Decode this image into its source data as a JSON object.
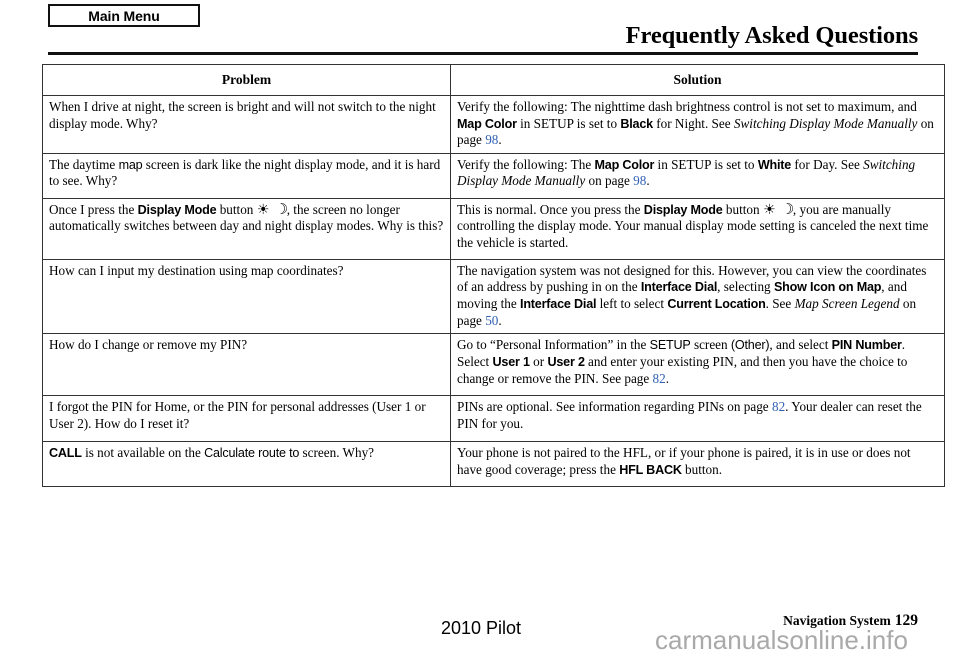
{
  "header": {
    "main_menu_label": "Main Menu",
    "title": "Frequently Asked Questions"
  },
  "table": {
    "columns": [
      "Problem",
      "Solution"
    ],
    "rows": [
      {
        "problem": "When I drive at night, the screen is bright and will not switch to the night display mode. Why?",
        "solution": "Verify the following: The nighttime dash brightness control is not set to maximum, and Map Color in SETUP is set to Black for Night. See Switching Display Mode Manually on page 98.",
        "solution_parts": {
          "t1": "Verify the following: The nighttime dash brightness control is not set to maximum, and ",
          "ui1": "Map Color",
          "t2": " in SETUP is set to ",
          "ui2": "Black",
          "t3": " for Night. See ",
          "ital1": "Switching Display Mode Manually",
          "t4": " on page ",
          "page": "98",
          "t5": "."
        }
      },
      {
        "problem_parts": {
          "t1": "The daytime ",
          "ui1": "map",
          "t2": " screen is dark like the night display mode, and it is hard to see. Why?"
        },
        "problem": "The daytime map screen is dark like the night display mode, and it is hard to see. Why?",
        "solution": "Verify the following: The Map Color in SETUP is set to White for Day. See Switching Display Mode Manually on page 98.",
        "solution_parts": {
          "t1": "Verify the following: The ",
          "ui1": "Map Color",
          "t2": " in SETUP is set to ",
          "ui2": "White",
          "t3": " for Day. See ",
          "ital1": "Switching Display Mode Manually",
          "t4": " on page ",
          "page": "98",
          "t5": "."
        }
      },
      {
        "problem": "Once I press the Display Mode button, the screen no longer automatically switches between day and night display modes. Why is this?",
        "problem_parts": {
          "t1": "Once I press the ",
          "ui1": "Display Mode",
          "t2": " button ",
          "icon": "display-mode-icon",
          "t3": ", the screen no longer automatically switches between day and night display modes. Why is this?"
        },
        "solution": "This is normal. Once you press the Display Mode button, you are manually controlling the display mode. Your manual display mode setting is canceled the next time the vehicle is started.",
        "solution_parts": {
          "t1": "This is normal. Once you press the ",
          "ui1": "Display Mode",
          "t2": " button ",
          "icon": "display-mode-icon",
          "t3": ", you are manually controlling the display mode. Your manual display mode setting is canceled the next time the vehicle is started."
        }
      },
      {
        "problem": "How can I input my destination using map coordinates?",
        "solution": "The navigation system was not designed for this. However, you can view the coordinates of an address by pushing in on the Interface Dial, selecting Show Icon on Map, and moving the Interface Dial left to select Current Location. See Map Screen Legend on page 50.",
        "solution_parts": {
          "t1": "The navigation system was not designed for this. However, you can view the coordinates of an address by pushing in on the ",
          "ui1": "Interface Dial",
          "t2": ", selecting ",
          "ui2": "Show Icon on Map",
          "t3": ", and moving the ",
          "ui3": "Interface Dial",
          "t4": " left to select ",
          "ui4": "Current Location",
          "t5": ". See ",
          "ital1": "Map Screen Legend",
          "t6": " on page ",
          "page": "50",
          "t7": "."
        }
      },
      {
        "problem": "How do I change or remove my PIN?",
        "solution": "Go to “Personal Information” in the SETUP screen (Other), and select PIN Number. Select User 1 or User 2 and enter your existing PIN, and then you have the choice to change or remove the PIN. See page 82.",
        "solution_parts": {
          "t1": "Go to “Personal Information” in the ",
          "uireg1": "SETUP",
          "t2": " screen ",
          "uireg2": "(Other)",
          "t3": ", and select ",
          "ui1": "PIN Number",
          "t4": ". Select ",
          "ui2": "User 1",
          "t5": " or ",
          "ui3": "User 2",
          "t6": " and enter your existing PIN, and then you have the choice to change or remove the PIN. See page ",
          "page": "82",
          "t7": "."
        }
      },
      {
        "problem": "I forgot the PIN for Home, or the PIN for personal addresses (User 1 or User 2). How do I reset it?",
        "solution": "PINs are optional. See information regarding PINs on page 82. Your dealer can reset the PIN for you.",
        "solution_parts": {
          "t1": "PINs are optional. See information regarding PINs on page ",
          "page": "82",
          "t2": ". Your dealer can reset the PIN for you."
        }
      },
      {
        "problem": "CALL is not available on the Calculate route to screen. Why?",
        "problem_parts": {
          "ui1": "CALL",
          "t1": " is not available on the ",
          "uireg1": "Calculate route to",
          "t2": " screen. Why?"
        },
        "solution": "Your phone is not paired to the HFL, or if your phone is paired, it is in use or does not have good coverage; press the HFL BACK button.",
        "solution_parts": {
          "t1": "Your phone is not paired to the HFL, or if your phone is paired, it is in use or does not have good coverage; press the ",
          "ui1": "HFL BACK",
          "t2": " button."
        }
      }
    ]
  },
  "footer": {
    "model": "2010 Pilot",
    "system_label": "Navigation System",
    "page_number": "129",
    "watermark": "carmanualsonline.info"
  },
  "colors": {
    "page_link": "#2f5fb4",
    "rule": "#111111",
    "watermark": "#a9a9a9"
  }
}
